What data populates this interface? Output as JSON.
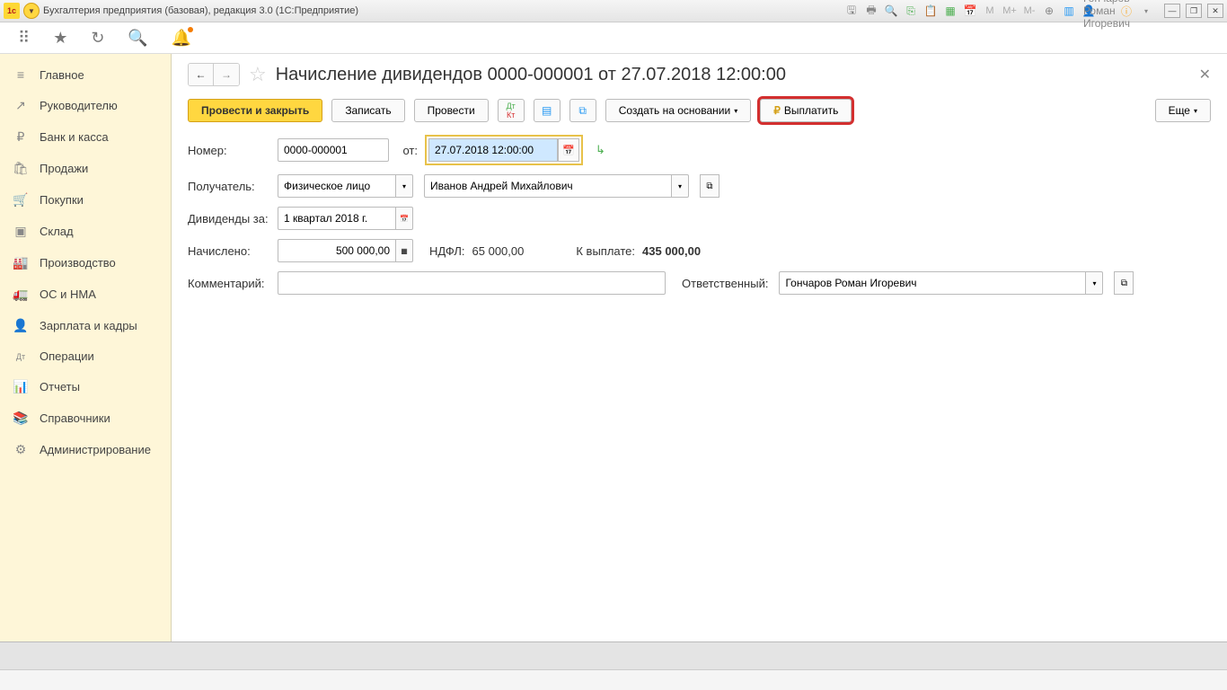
{
  "titlebar": {
    "logo_text": "1с",
    "title": "Бухгалтерия предприятия (базовая), редакция 3.0  (1С:Предприятие)",
    "m_labels": [
      "M",
      "M+",
      "M-"
    ],
    "user_name": "Гончаров Роман Игоревич"
  },
  "sidebar": {
    "items": [
      {
        "icon": "≡",
        "label": "Главное"
      },
      {
        "icon": "↗",
        "label": "Руководителю"
      },
      {
        "icon": "₽",
        "label": "Банк и касса"
      },
      {
        "icon": "🛍",
        "label": "Продажи"
      },
      {
        "icon": "🛒",
        "label": "Покупки"
      },
      {
        "icon": "▣",
        "label": "Склад"
      },
      {
        "icon": "🏭",
        "label": "Производство"
      },
      {
        "icon": "🚛",
        "label": "ОС и НМА"
      },
      {
        "icon": "👤",
        "label": "Зарплата и кадры"
      },
      {
        "icon": "Дт",
        "label": "Операции"
      },
      {
        "icon": "📊",
        "label": "Отчеты"
      },
      {
        "icon": "📚",
        "label": "Справочники"
      },
      {
        "icon": "⚙",
        "label": "Администрирование"
      }
    ]
  },
  "header": {
    "title": "Начисление дивидендов 0000-000001 от 27.07.2018 12:00:00"
  },
  "actions": {
    "post_close": "Провести и закрыть",
    "save": "Записать",
    "post": "Провести",
    "create_based": "Создать на основании",
    "pay": "Выплатить",
    "more": "Еще"
  },
  "form": {
    "number_label": "Номер:",
    "number_value": "0000-000001",
    "date_label": "от:",
    "date_value": "27.07.2018 12:00:00",
    "recipient_label": "Получатель:",
    "recipient_type": "Физическое лицо",
    "recipient_name": "Иванов Андрей Михайлович",
    "period_label": "Дивиденды за:",
    "period_value": "1 квартал 2018 г.",
    "accrued_label": "Начислено:",
    "accrued_value": "500 000,00",
    "ndfl_label": "НДФЛ:",
    "ndfl_value": "65 000,00",
    "payout_label": "К выплате:",
    "payout_value": "435 000,00",
    "comment_label": "Комментарий:",
    "comment_value": "",
    "responsible_label": "Ответственный:",
    "responsible_value": "Гончаров Роман Игоревич"
  }
}
